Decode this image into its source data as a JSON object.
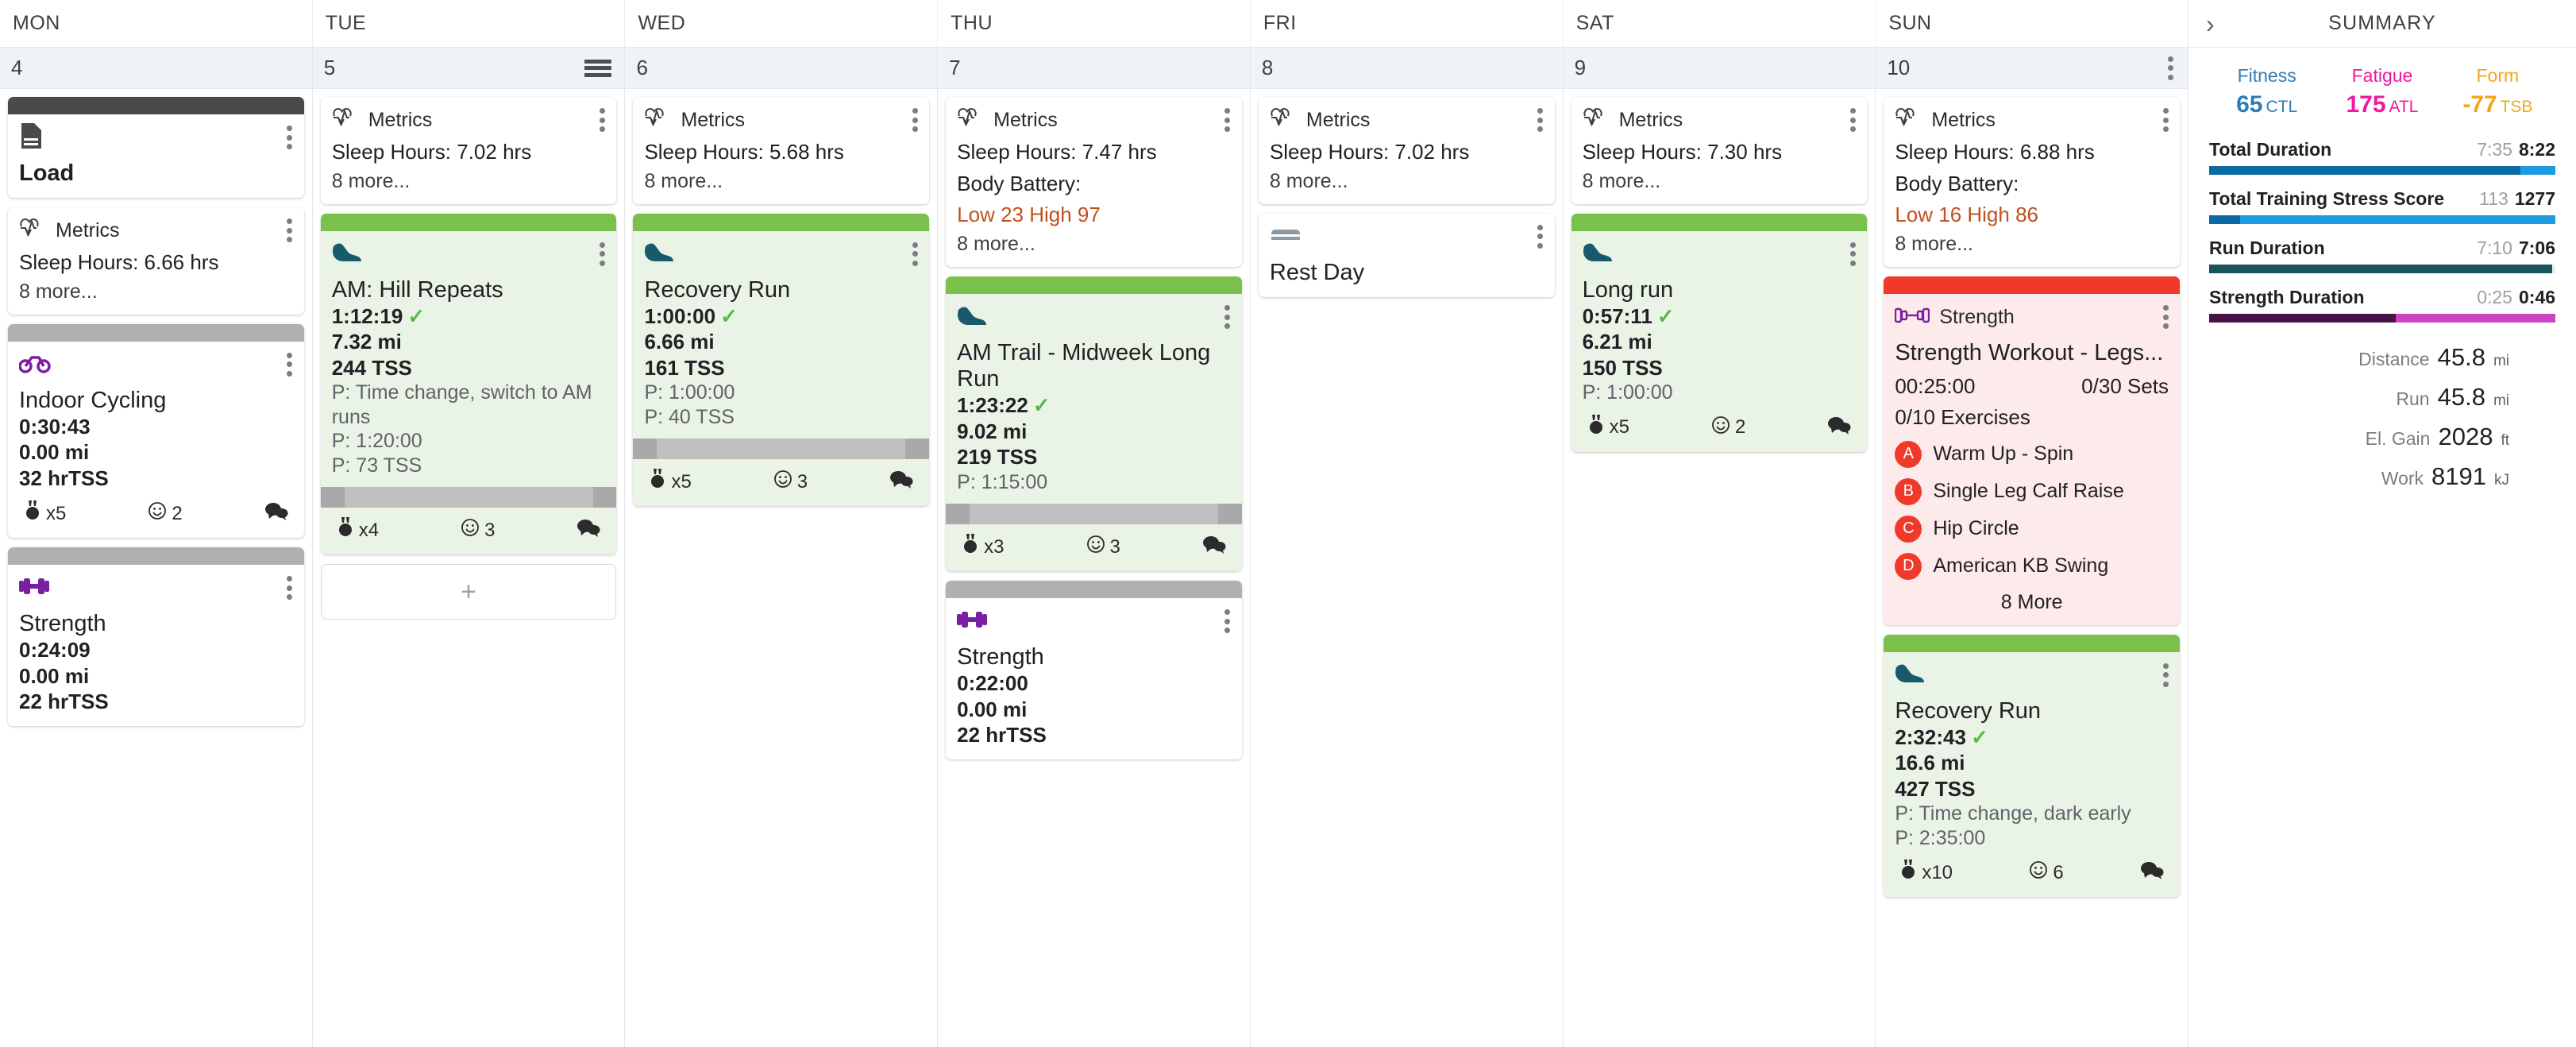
{
  "weekdays": [
    "MON",
    "TUE",
    "WED",
    "THU",
    "FRI",
    "SAT",
    "SUN"
  ],
  "labels": {
    "metrics": "Metrics",
    "more_suffix": "8 more...",
    "add": "+"
  },
  "colors": {
    "green_strip": "#79c14c",
    "gray_strip": "#b0b0b0",
    "red_strip": "#f0392b",
    "dark_strip": "#4a4a4a",
    "fitness": "#2e7eb8",
    "fatigue": "#f0189f",
    "form": "#f0a81b",
    "body_battery": "#c0501e"
  },
  "days": [
    {
      "num": "4",
      "menu": "none",
      "cards": [
        {
          "type": "load",
          "strip": "dark",
          "icon": "document-icon",
          "title": "Load"
        },
        {
          "type": "metrics",
          "strip": "none",
          "icon": "heartbeat-icon",
          "header": "Metrics",
          "lines": [
            "Sleep Hours: 6.66 hrs"
          ],
          "more": "8 more..."
        },
        {
          "type": "activity",
          "strip": "gray",
          "icon": "bike-icon",
          "icon_color": "#7b1fa2",
          "title": "Indoor Cycling",
          "stats": [
            "0:30:43",
            "0.00 mi",
            "32 hrTSS"
          ],
          "completed": false,
          "notes": [],
          "footer": {
            "medal": "x5",
            "smile": "2",
            "comment": true
          }
        },
        {
          "type": "activity",
          "strip": "gray",
          "icon": "dumbbell-icon",
          "icon_color": "#7b1fa2",
          "title": "Strength",
          "stats": [
            "0:24:09",
            "0.00 mi",
            "22 hrTSS"
          ],
          "completed": false,
          "notes": [],
          "footer": null
        }
      ]
    },
    {
      "num": "5",
      "menu": "hamburger",
      "cards": [
        {
          "type": "metrics",
          "strip": "none",
          "icon": "heartbeat-icon",
          "header": "Metrics",
          "lines": [
            "Sleep Hours: 7.02 hrs"
          ],
          "more": "8 more..."
        },
        {
          "type": "activity",
          "strip": "green",
          "icon": "running-shoe-icon",
          "icon_color": "#185a6b",
          "title": "AM: Hill Repeats",
          "stats": [
            "1:12:19",
            "7.32 mi",
            "244 TSS"
          ],
          "completed": true,
          "notes": [
            "P: Time change, switch to AM runs",
            "P: 1:20:00",
            "P: 73 TSS"
          ],
          "bar": true,
          "footer": {
            "medal": "x4",
            "smile": "3",
            "comment": true
          }
        },
        {
          "type": "add",
          "label": "+"
        }
      ]
    },
    {
      "num": "6",
      "menu": "none",
      "cards": [
        {
          "type": "metrics",
          "strip": "none",
          "icon": "heartbeat-icon",
          "header": "Metrics",
          "lines": [
            "Sleep Hours: 5.68 hrs"
          ],
          "more": "8 more..."
        },
        {
          "type": "activity",
          "strip": "green",
          "icon": "running-shoe-icon",
          "icon_color": "#185a6b",
          "title": "Recovery Run",
          "stats": [
            "1:00:00",
            "6.66 mi",
            "161 TSS"
          ],
          "completed": true,
          "notes": [
            "P: 1:00:00",
            "P: 40 TSS"
          ],
          "bar": true,
          "footer": {
            "medal": "x5",
            "smile": "3",
            "comment": true
          }
        }
      ]
    },
    {
      "num": "7",
      "menu": "none",
      "cards": [
        {
          "type": "metrics",
          "strip": "none",
          "icon": "heartbeat-icon",
          "header": "Metrics",
          "lines": [
            "Sleep Hours: 7.47 hrs",
            "Body Battery:"
          ],
          "battery": "Low 23 High 97",
          "more": "8 more..."
        },
        {
          "type": "activity",
          "strip": "green",
          "icon": "running-shoe-icon",
          "icon_color": "#185a6b",
          "title": "AM Trail - Midweek Long Run",
          "stats": [
            "1:23:22",
            "9.02 mi",
            "219 TSS"
          ],
          "completed": true,
          "notes": [
            "P: 1:15:00"
          ],
          "bar": true,
          "footer": {
            "medal": "x3",
            "smile": "3",
            "comment": true
          }
        },
        {
          "type": "activity",
          "strip": "gray",
          "icon": "dumbbell-icon",
          "icon_color": "#7b1fa2",
          "title": "Strength",
          "stats": [
            "0:22:00",
            "0.00 mi",
            "22 hrTSS"
          ],
          "completed": false,
          "notes": [],
          "footer": null
        }
      ]
    },
    {
      "num": "8",
      "menu": "none",
      "cards": [
        {
          "type": "metrics",
          "strip": "none",
          "icon": "heartbeat-icon",
          "header": "Metrics",
          "lines": [
            "Sleep Hours: 7.02 hrs"
          ],
          "more": "8 more..."
        },
        {
          "type": "rest",
          "strip": "none",
          "icon": "rest-day-icon",
          "title": "Rest Day"
        }
      ]
    },
    {
      "num": "9",
      "menu": "none",
      "cards": [
        {
          "type": "metrics",
          "strip": "none",
          "icon": "heartbeat-icon",
          "header": "Metrics",
          "lines": [
            "Sleep Hours: 7.30 hrs"
          ],
          "more": "8 more..."
        },
        {
          "type": "activity",
          "strip": "green",
          "icon": "running-shoe-icon",
          "icon_color": "#185a6b",
          "title": "Long run",
          "stats": [
            "0:57:11",
            "6.21 mi",
            "150 TSS"
          ],
          "completed": true,
          "notes": [
            "P: 1:00:00"
          ],
          "footer": {
            "medal": "x5",
            "smile": "2",
            "comment": true
          }
        }
      ]
    },
    {
      "num": "10",
      "menu": "kebab",
      "cards": [
        {
          "type": "metrics",
          "strip": "none",
          "icon": "heartbeat-icon",
          "header": "Metrics",
          "lines": [
            "Sleep Hours: 6.88 hrs",
            "Body Battery:"
          ],
          "battery": "Low 16 High 86",
          "more": "8 more..."
        },
        {
          "type": "strength_plan",
          "strip": "red",
          "icon": "barbell-icon",
          "header": "Strength",
          "title": "Strength Workout - Legs...",
          "duration": "00:25:00",
          "sets": "0/30 Sets",
          "exercises_count": "0/10 Exercises",
          "exercises": [
            {
              "badge": "A",
              "name": "Warm Up - Spin"
            },
            {
              "badge": "B",
              "name": "Single Leg Calf Raise"
            },
            {
              "badge": "C",
              "name": "Hip Circle"
            },
            {
              "badge": "D",
              "name": "American KB Swing"
            }
          ],
          "more": "8 More"
        },
        {
          "type": "activity",
          "strip": "green",
          "icon": "running-shoe-icon",
          "icon_color": "#185a6b",
          "title": "Recovery Run",
          "stats": [
            "2:32:43",
            "16.6 mi",
            "427 TSS"
          ],
          "completed": true,
          "notes": [
            "P: Time change, dark early",
            "P: 2:35:00"
          ],
          "footer": {
            "medal": "x10",
            "smile": "6",
            "comment": true
          }
        }
      ]
    }
  ],
  "summary": {
    "title": "SUMMARY",
    "collapse_icon": "chevron-right-icon",
    "pmc": [
      {
        "label": "Fitness",
        "value": "65",
        "unit": "CTL",
        "color": "#2e7eb8"
      },
      {
        "label": "Fatigue",
        "value": "175",
        "unit": "ATL",
        "color": "#f0189f"
      },
      {
        "label": "Form",
        "value": "-77",
        "unit": "TSB",
        "color": "#f0a81b"
      }
    ],
    "rows": [
      {
        "label": "Total Duration",
        "planned": "7:35",
        "actual": "8:22",
        "bar_a_pct": 90,
        "bar_b_pct": 100,
        "color_a": "#0b6aa2",
        "color_b": "#1e9ae0"
      },
      {
        "label": "Total Training Stress Score",
        "planned": "113",
        "actual": "1277",
        "bar_a_pct": 9,
        "bar_b_pct": 100,
        "color_a": "#0b6aa2",
        "color_b": "#1e9ae0"
      },
      {
        "label": "Run Duration",
        "planned": "7:10",
        "actual": "7:06",
        "bar_a_pct": 99,
        "bar_b_pct": 99,
        "color_a": "#18535e",
        "color_b": "#18535e"
      },
      {
        "label": "Strength Duration",
        "planned": "0:25",
        "actual": "0:46",
        "bar_a_pct": 54,
        "bar_b_pct": 100,
        "color_a": "#4a1347",
        "color_b": "#cc44c0"
      }
    ],
    "totals": [
      {
        "label": "Distance",
        "value": "45.8",
        "unit": "mi"
      },
      {
        "label": "Run",
        "value": "45.8",
        "unit": "mi"
      },
      {
        "label": "El. Gain",
        "value": "2028",
        "unit": "ft"
      },
      {
        "label": "Work",
        "value": "8191",
        "unit": "kJ"
      }
    ]
  }
}
